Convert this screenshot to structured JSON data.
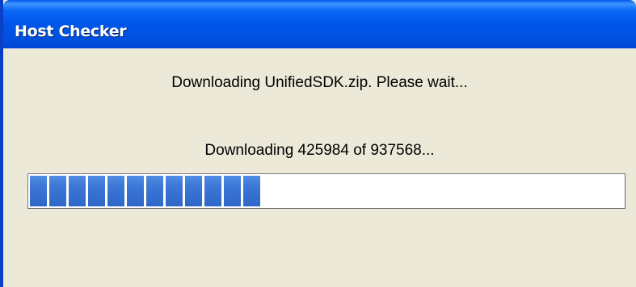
{
  "window": {
    "title": "Host Checker"
  },
  "content": {
    "status_message": "Downloading UnifiedSDK.zip. Please wait...",
    "progress_message": "Downloading 425984 of 937568..."
  },
  "progress": {
    "bytes_downloaded": 425984,
    "bytes_total": 937568,
    "segments_shown": 12,
    "fraction_shown": 0.44
  },
  "colors": {
    "titlebar": "#0055e8",
    "window_background": "#ece9d8",
    "progress_segment": "#3670d1"
  }
}
